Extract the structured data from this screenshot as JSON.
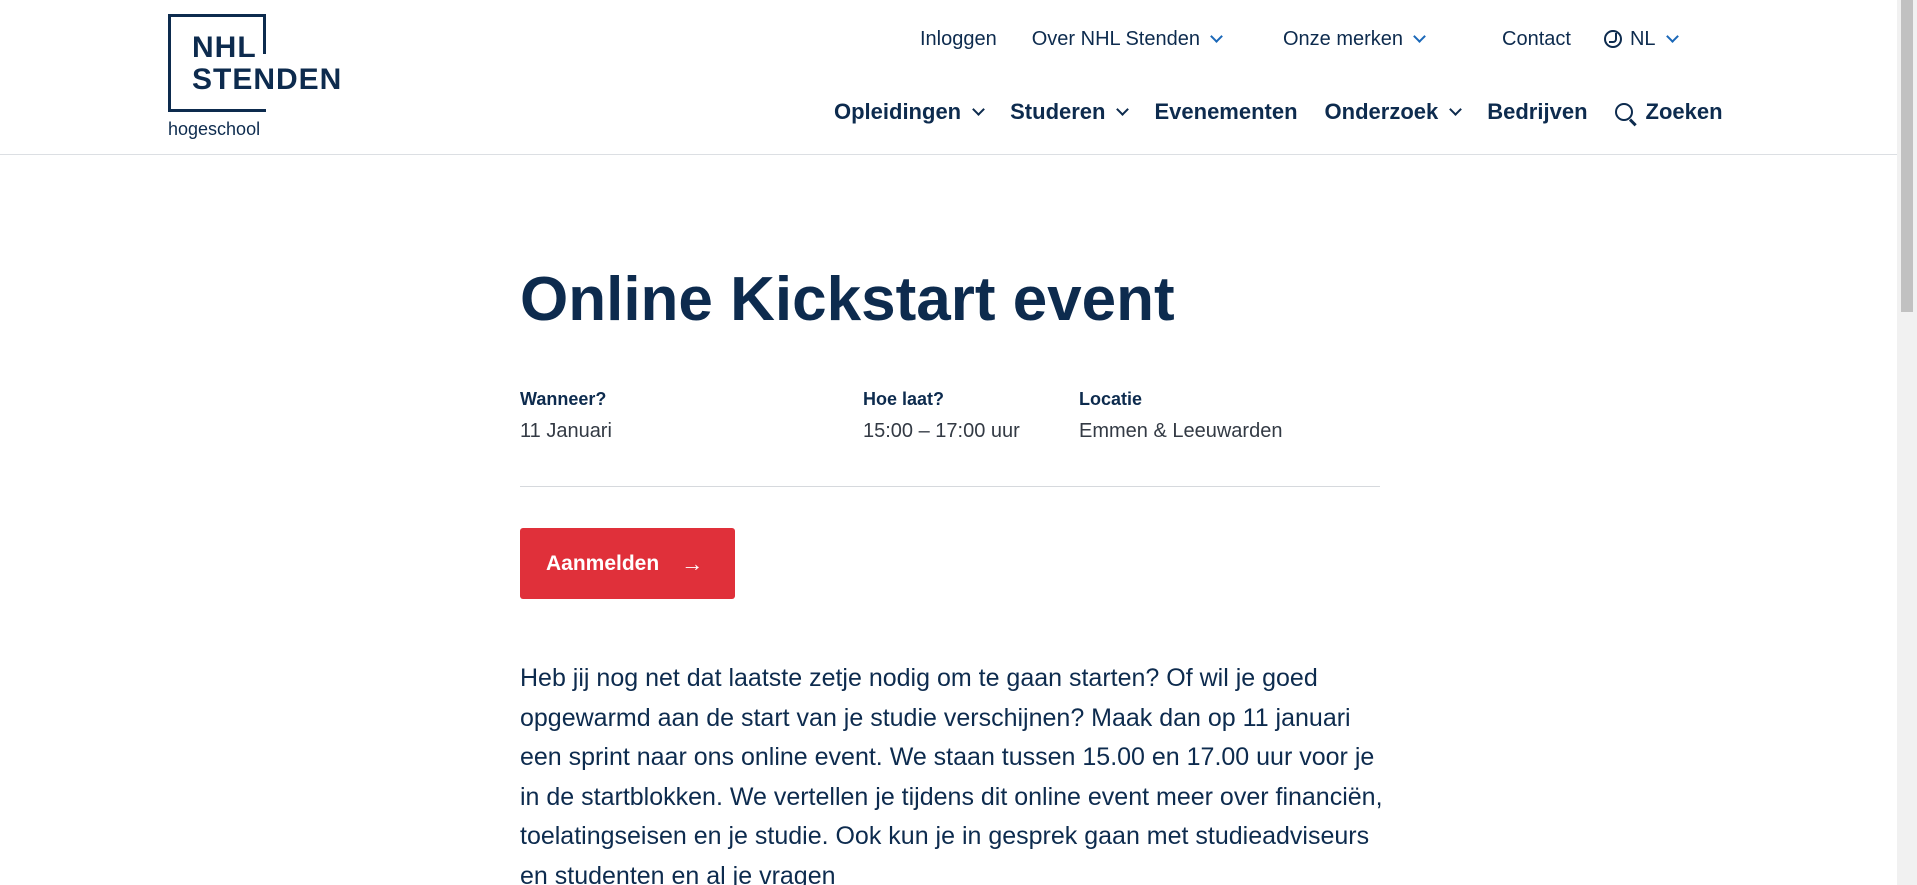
{
  "brand": {
    "logo_line1": "NHL",
    "logo_line2": "STENDEN",
    "logo_sub": "hogeschool"
  },
  "topnav": {
    "login": "Inloggen",
    "about": "Over NHL Stenden",
    "brands": "Onze merken",
    "contact": "Contact",
    "language": "NL"
  },
  "mainnav": {
    "items": [
      "Opleidingen",
      "Studeren",
      "Evenementen",
      "Onderzoek",
      "Bedrijven"
    ],
    "search": "Zoeken"
  },
  "event": {
    "title": "Online Kickstart event",
    "when_label": "Wanneer?",
    "when_value": "11 Januari",
    "time_label": "Hoe laat?",
    "time_value": "15:00 – 17:00 uur",
    "location_label": "Locatie",
    "location_value": "Emmen & Leeuwarden",
    "register_button": "Aanmelden",
    "description": "Heb jij nog net dat laatste zetje nodig om te gaan starten? Of wil je goed opgewarmd aan de start van je studie verschijnen? Maak dan op 11 januari een sprint naar ons online event. We staan tussen 15.00 en 17.00 uur voor je in de startblokken. We vertellen je tijdens dit online event meer over financiën, toelatingseisen en je studie. Ook kun je in gesprek gaan met studieadviseurs en studenten en al je vragen"
  },
  "colors": {
    "navy": "#0d2b4e",
    "accent_red": "#e0303a",
    "chevron_blue": "#1b68b8"
  },
  "icons": [
    "chevron-down-icon",
    "globe-icon",
    "search-icon",
    "arrow-right-icon"
  ]
}
